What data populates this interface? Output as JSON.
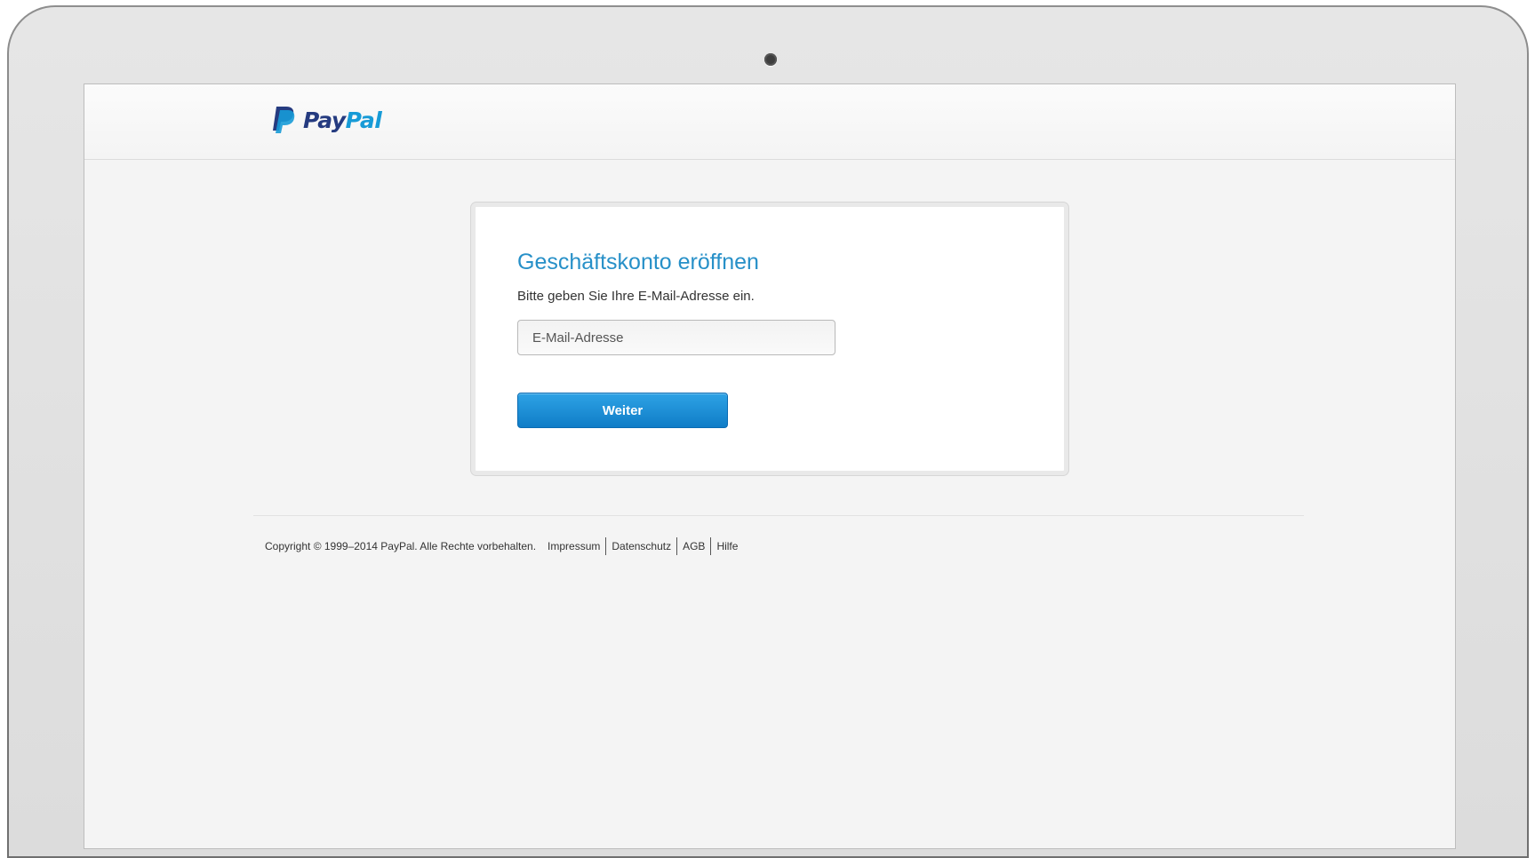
{
  "header": {
    "logo_text_1": "Pay",
    "logo_text_2": "Pal"
  },
  "signup_card": {
    "title": "Geschäftskonto eröffnen",
    "subtitle": "Bitte geben Sie Ihre E-Mail-Adresse ein.",
    "email_placeholder": "E-Mail-Adresse",
    "email_value": "",
    "continue_label": "Weiter"
  },
  "footer": {
    "copyright": "Copyright © 1999–2014 PayPal. Alle Rechte vorbehalten.",
    "links": [
      "Impressum",
      "Datenschutz",
      "AGB",
      "Hilfe"
    ]
  },
  "colors": {
    "brand_dark": "#253b80",
    "brand_light": "#179bd7",
    "title_blue": "#2790c8",
    "button_blue": "#1a8bd3"
  }
}
